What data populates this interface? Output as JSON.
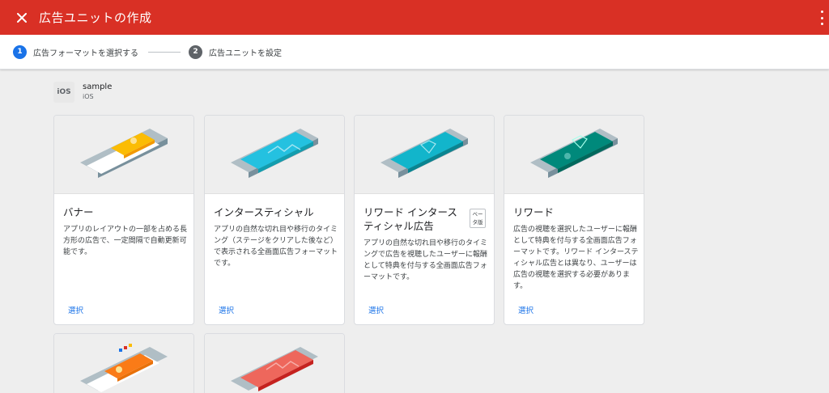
{
  "topbar": {
    "title": "広告ユニットの作成"
  },
  "stepper": {
    "steps": [
      {
        "number": "1",
        "label": "広告フォーマットを選択する"
      },
      {
        "number": "2",
        "label": "広告ユニットを設定"
      }
    ]
  },
  "app": {
    "icon_text": "iOS",
    "name": "sample",
    "platform": "iOS"
  },
  "cards": [
    {
      "title": "バナー",
      "description": "アプリのレイアウトの一部を占める長方形の広告で、一定間隔で自動更新可能です。",
      "select_label": "選択",
      "accent": "#fbbc04"
    },
    {
      "title": "インタースティシャル",
      "description": "アプリの自然な切れ目や移行のタイミング（ステージをクリアした後など）で表示される全画面広告フォーマットです。",
      "select_label": "選択",
      "accent": "#24c1e0"
    },
    {
      "title": "リワード インタースティシャル広告",
      "badge": "ベータ版",
      "description": "アプリの自然な切れ目や移行のタイミングで広告を視聴したユーザーに報酬として特典を付与する全画面広告フォーマットです。",
      "select_label": "選択",
      "accent": "#12b5cb"
    },
    {
      "title": "リワード",
      "description": "広告の視聴を選択したユーザーに報酬として特典を付与する全画面広告フォーマットです。リワード インタースティシャル広告とは異なり、ユーザーは広告の視聴を選択する必要があります。",
      "select_label": "選択",
      "accent": "#00897b"
    },
    {
      "accent": "#fa7b17"
    },
    {
      "accent": "#ee675c"
    }
  ],
  "colors": {
    "header": "#d93025",
    "link": "#1a73e8",
    "step_active": "#1a73e8",
    "step_inactive": "#5f6368"
  },
  "icons": {
    "close": "close-icon",
    "menu": "more-vert-icon"
  }
}
